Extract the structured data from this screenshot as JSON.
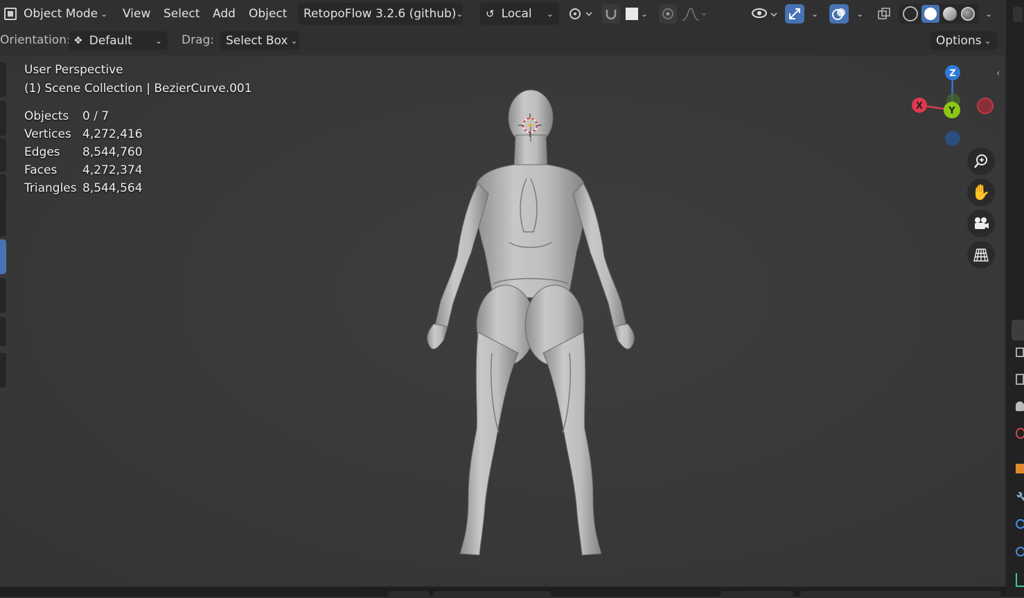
{
  "header": {
    "mode": "Object Mode",
    "menus": [
      "View",
      "Select",
      "Add",
      "Object"
    ],
    "addon": "RetopoFlow 3.2.6 (github)",
    "pivot": "Local"
  },
  "toolbar": {
    "orientation_label": "Orientation:",
    "orientation_value": "Default",
    "drag_label": "Drag:",
    "drag_value": "Select Box",
    "options_label": "Options"
  },
  "viewport": {
    "perspective": "User Perspective",
    "collection": "(1) Scene Collection | BezierCurve.001",
    "stats": [
      {
        "label": "Objects",
        "value": "0 / 7"
      },
      {
        "label": "Vertices",
        "value": "4,272,416"
      },
      {
        "label": "Edges",
        "value": "8,544,760"
      },
      {
        "label": "Faces",
        "value": "4,272,374"
      },
      {
        "label": "Triangles",
        "value": "8,544,564"
      }
    ]
  },
  "gizmo": {
    "z": "Z",
    "y": "Y",
    "x": "X"
  },
  "colors": {
    "x_axis": "#e0384d",
    "y_axis": "#8bc715",
    "z_axis": "#2e7ad6",
    "accent": "#4772b3"
  }
}
